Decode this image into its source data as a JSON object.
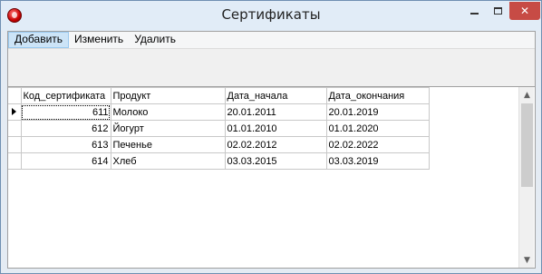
{
  "window": {
    "title": "Сертификаты",
    "close_glyph": "✕",
    "icon": "app-red-icon"
  },
  "menu": {
    "items": [
      "Добавить",
      "Изменить",
      "Удалить"
    ],
    "active_index": 0
  },
  "grid": {
    "columns": [
      "Код_сертификата",
      "Продукт",
      "Дата_начала",
      "Дата_окончания"
    ],
    "rows": [
      [
        "611",
        "Молоко",
        "20.01.2011",
        "20.01.2019"
      ],
      [
        "612",
        "Йогурт",
        "01.01.2010",
        "01.01.2020"
      ],
      [
        "613",
        "Печенье",
        "02.02.2012",
        "02.02.2022"
      ],
      [
        "614",
        "Хлеб",
        "03.03.2015",
        "03.03.2019"
      ]
    ],
    "current_row": 0
  },
  "scrollbar": {
    "up_glyph": "▲",
    "down_glyph": "▼"
  },
  "colors": {
    "close_button": "#c74b45",
    "menu_active": "#cce4f7",
    "titlebar": "#e1ecf7"
  }
}
